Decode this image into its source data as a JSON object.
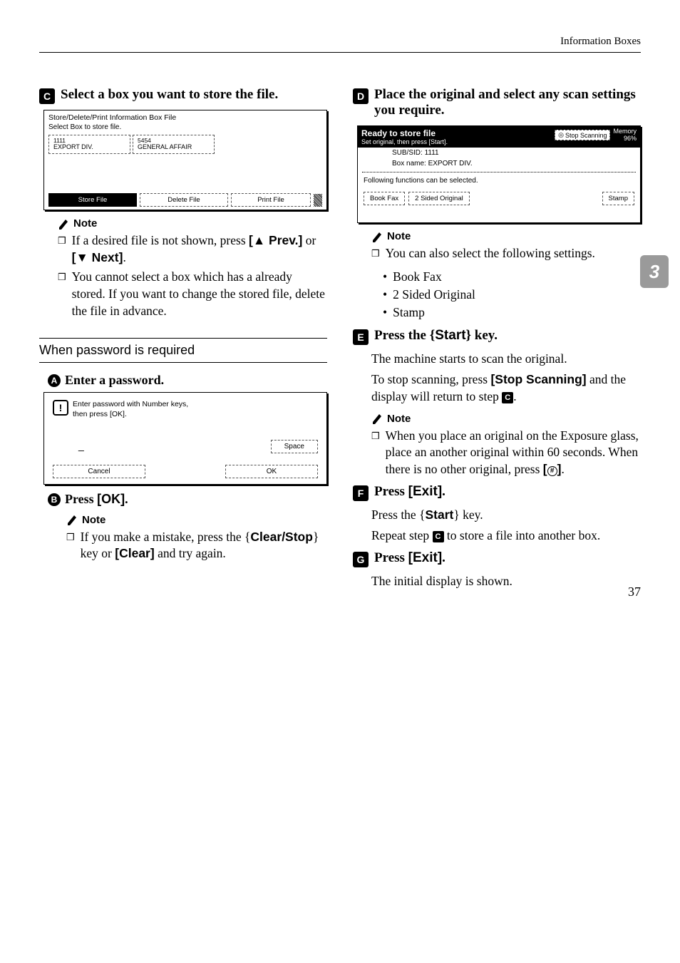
{
  "header": {
    "caption": "Information Boxes"
  },
  "side_tab": "3",
  "page_number": "37",
  "left": {
    "step3": "Select a box you want to store the file.",
    "ss1": {
      "title": "Store/Delete/Print Information Box File",
      "sub": "Select Box to store file.",
      "box1_code": "1111",
      "box1_name": "EXPORT DIV.",
      "box2_code": "5454",
      "box2_name": "GENERAL AFFAIR",
      "btn_store": "Store File",
      "btn_delete": "Delete File",
      "btn_print": "Print File"
    },
    "note_label": "Note",
    "note1_item1_a": "If a desired file is not shown, press ",
    "note1_item1_prev": "[▲ Prev.]",
    "note1_item1_or": " or ",
    "note1_item1_next": "[▼ Next]",
    "note1_item2": "You cannot select a box which has a already stored. If you want to change the stored file, delete the file in advance.",
    "subhead": "When password is required",
    "sub1": "Enter a password.",
    "ss2": {
      "msg1": "Enter password with Number keys,",
      "msg2": "then press [OK].",
      "entry": "_",
      "space": "Space",
      "cancel": "Cancel",
      "ok": "OK"
    },
    "sub2_a": "Press ",
    "sub2_b": "[OK]",
    "sub2_c": ".",
    "note2_a": "If you make a mistake, press the ",
    "note2_key1": "Clear/Stop",
    "note2_b": " key or ",
    "note2_key2": "[Clear]",
    "note2_c": " and try again."
  },
  "right": {
    "step4": "Place the original and select any scan settings you require.",
    "ss3": {
      "title": "Ready to store file",
      "sub": "Set original, then press [Start].",
      "stop": "Stop Scanning",
      "mem1": "Memory",
      "mem2": "96%",
      "info1": "SUB/SID: 1111",
      "info2": "Box name: EXPORT DIV.",
      "func": "Following functions can be selected.",
      "btn1": "Book Fax",
      "btn2": "2 Sided Original",
      "btn3": "Stamp"
    },
    "note_label": "Note",
    "note1_lead": "You can also select the following settings.",
    "note1_b1": "Book Fax",
    "note1_b2": "2 Sided Original",
    "note1_b3": "Stamp",
    "step5_a": "Press the ",
    "step5_key": "Start",
    "step5_b": " key.",
    "step5_body1": "The machine starts to scan the original.",
    "step5_body2_a": "To stop scanning, press ",
    "step5_body2_key": "[Stop Scanning]",
    "step5_body2_b": " and the display will return to step ",
    "step5_body2_c": ".",
    "note2_a": "When you place an original on the Exposure glass, place an another original within 60 seconds. When there is no other original, press ",
    "note2_b": ".",
    "step6_a": "Press ",
    "step6_key": "[Exit]",
    "step6_b": ".",
    "step6_body1_a": "Press the ",
    "step6_body1_key": "Start",
    "step6_body1_b": " key.",
    "step6_body2_a": "Repeat step ",
    "step6_body2_b": " to store a file into another box.",
    "step7_a": "Press ",
    "step7_key": "[Exit]",
    "step7_b": ".",
    "step7_body": "The initial display is shown."
  }
}
